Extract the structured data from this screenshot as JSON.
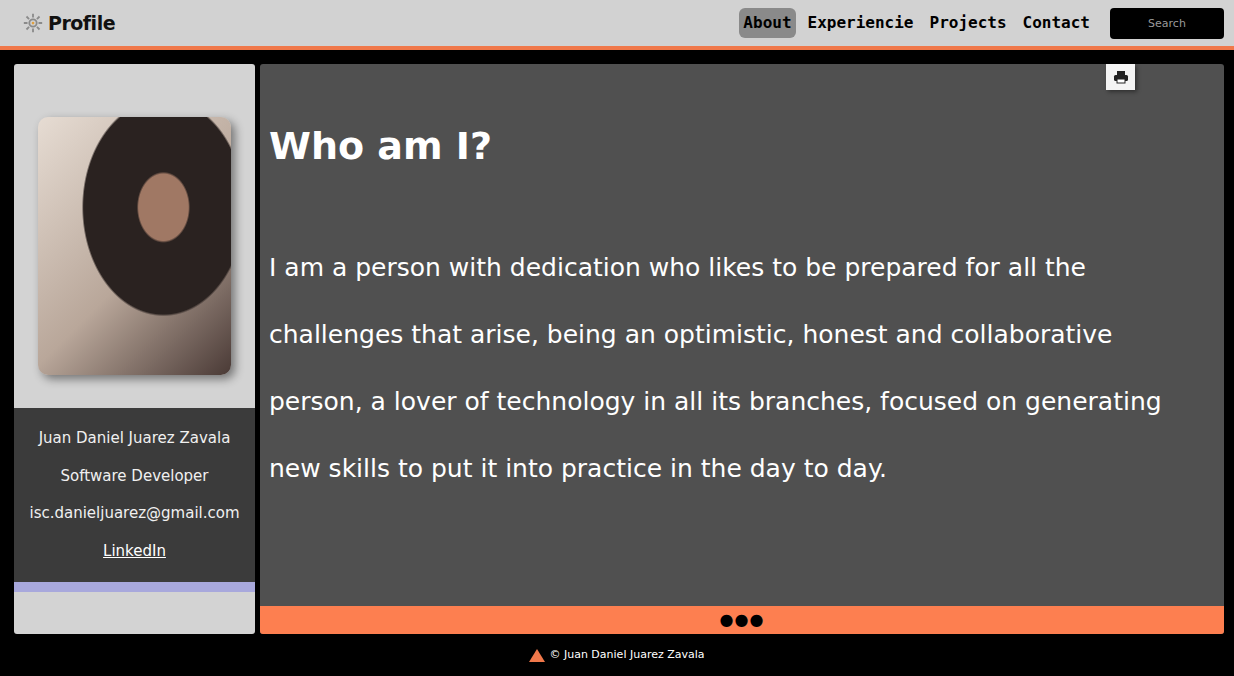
{
  "navbar": {
    "brand": "Profile",
    "items": [
      {
        "label": "About",
        "selected": true
      },
      {
        "label": "Experiencie",
        "selected": false
      },
      {
        "label": "Projects",
        "selected": false
      },
      {
        "label": "Contact",
        "selected": false
      }
    ],
    "search": {
      "placeholder": "Search"
    }
  },
  "sidebar": {
    "name": "Juan Daniel Juarez Zavala",
    "role": "Software Developer",
    "email": "isc.danieljuarez@gmail.com",
    "link": "LinkedIn"
  },
  "main": {
    "title": "Who am I?",
    "paragraph": "I am a person with dedication who likes to be prepared for all the challenges that arise, being an optimistic, honest and collaborative person, a lover of technology in all its branches, focused on generating new skills to put it into practice in the day to day.",
    "pager": "●●●"
  },
  "footer": {
    "text": "© Juan Daniel Juarez Zavala"
  }
}
